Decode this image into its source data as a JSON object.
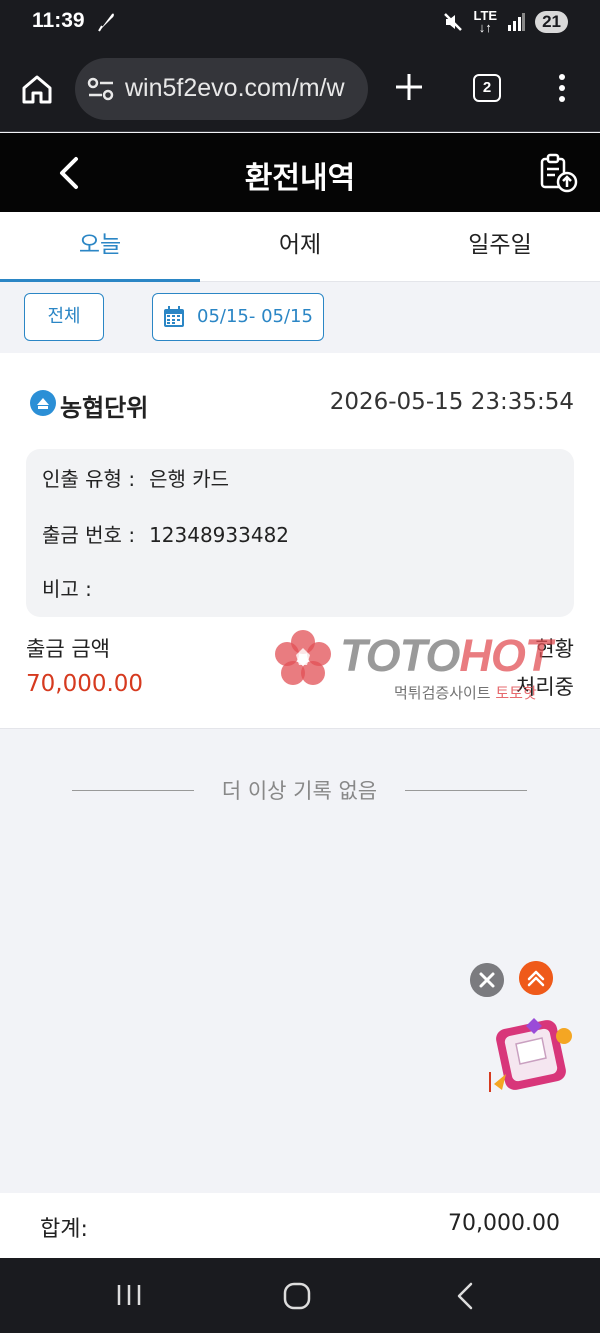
{
  "status_bar": {
    "time": "11:39",
    "network": "LTE",
    "battery": "21"
  },
  "browser": {
    "url": "win5f2evo.com/m/w",
    "tab_count": "2"
  },
  "header": {
    "title": "환전내역"
  },
  "tabs": [
    {
      "label": "오늘",
      "active": true
    },
    {
      "label": "어제",
      "active": false
    },
    {
      "label": "일주일",
      "active": false
    }
  ],
  "filters": {
    "all_label": "전체",
    "date_range": "05/15- 05/15"
  },
  "record": {
    "bank": "농협단위",
    "datetime": "2026-05-15 23:35:54",
    "withdraw_type_label": "인출 유형 :",
    "withdraw_type_value": "은행 카드",
    "account_label": "출금 번호 :",
    "account_value": "12348933482",
    "memo_label": "비고 :",
    "memo_value": "",
    "amount_label": "출금 금액",
    "amount_value": "70,000.00",
    "status_label": "현황",
    "status_value": "처리중"
  },
  "watermark": {
    "brand_part1": "TOTO",
    "brand_part2": "HOT",
    "sub_part1": "먹튀검증사이트 ",
    "sub_part2": "토토핫"
  },
  "end_note": "더 이상 기록 없음",
  "total": {
    "label": "합계:",
    "value": "70,000.00"
  },
  "colors": {
    "accent": "#2b86c5",
    "amount": "#d63a1f",
    "header_bg": "#050505",
    "status_bg": "#1a1b1f"
  }
}
